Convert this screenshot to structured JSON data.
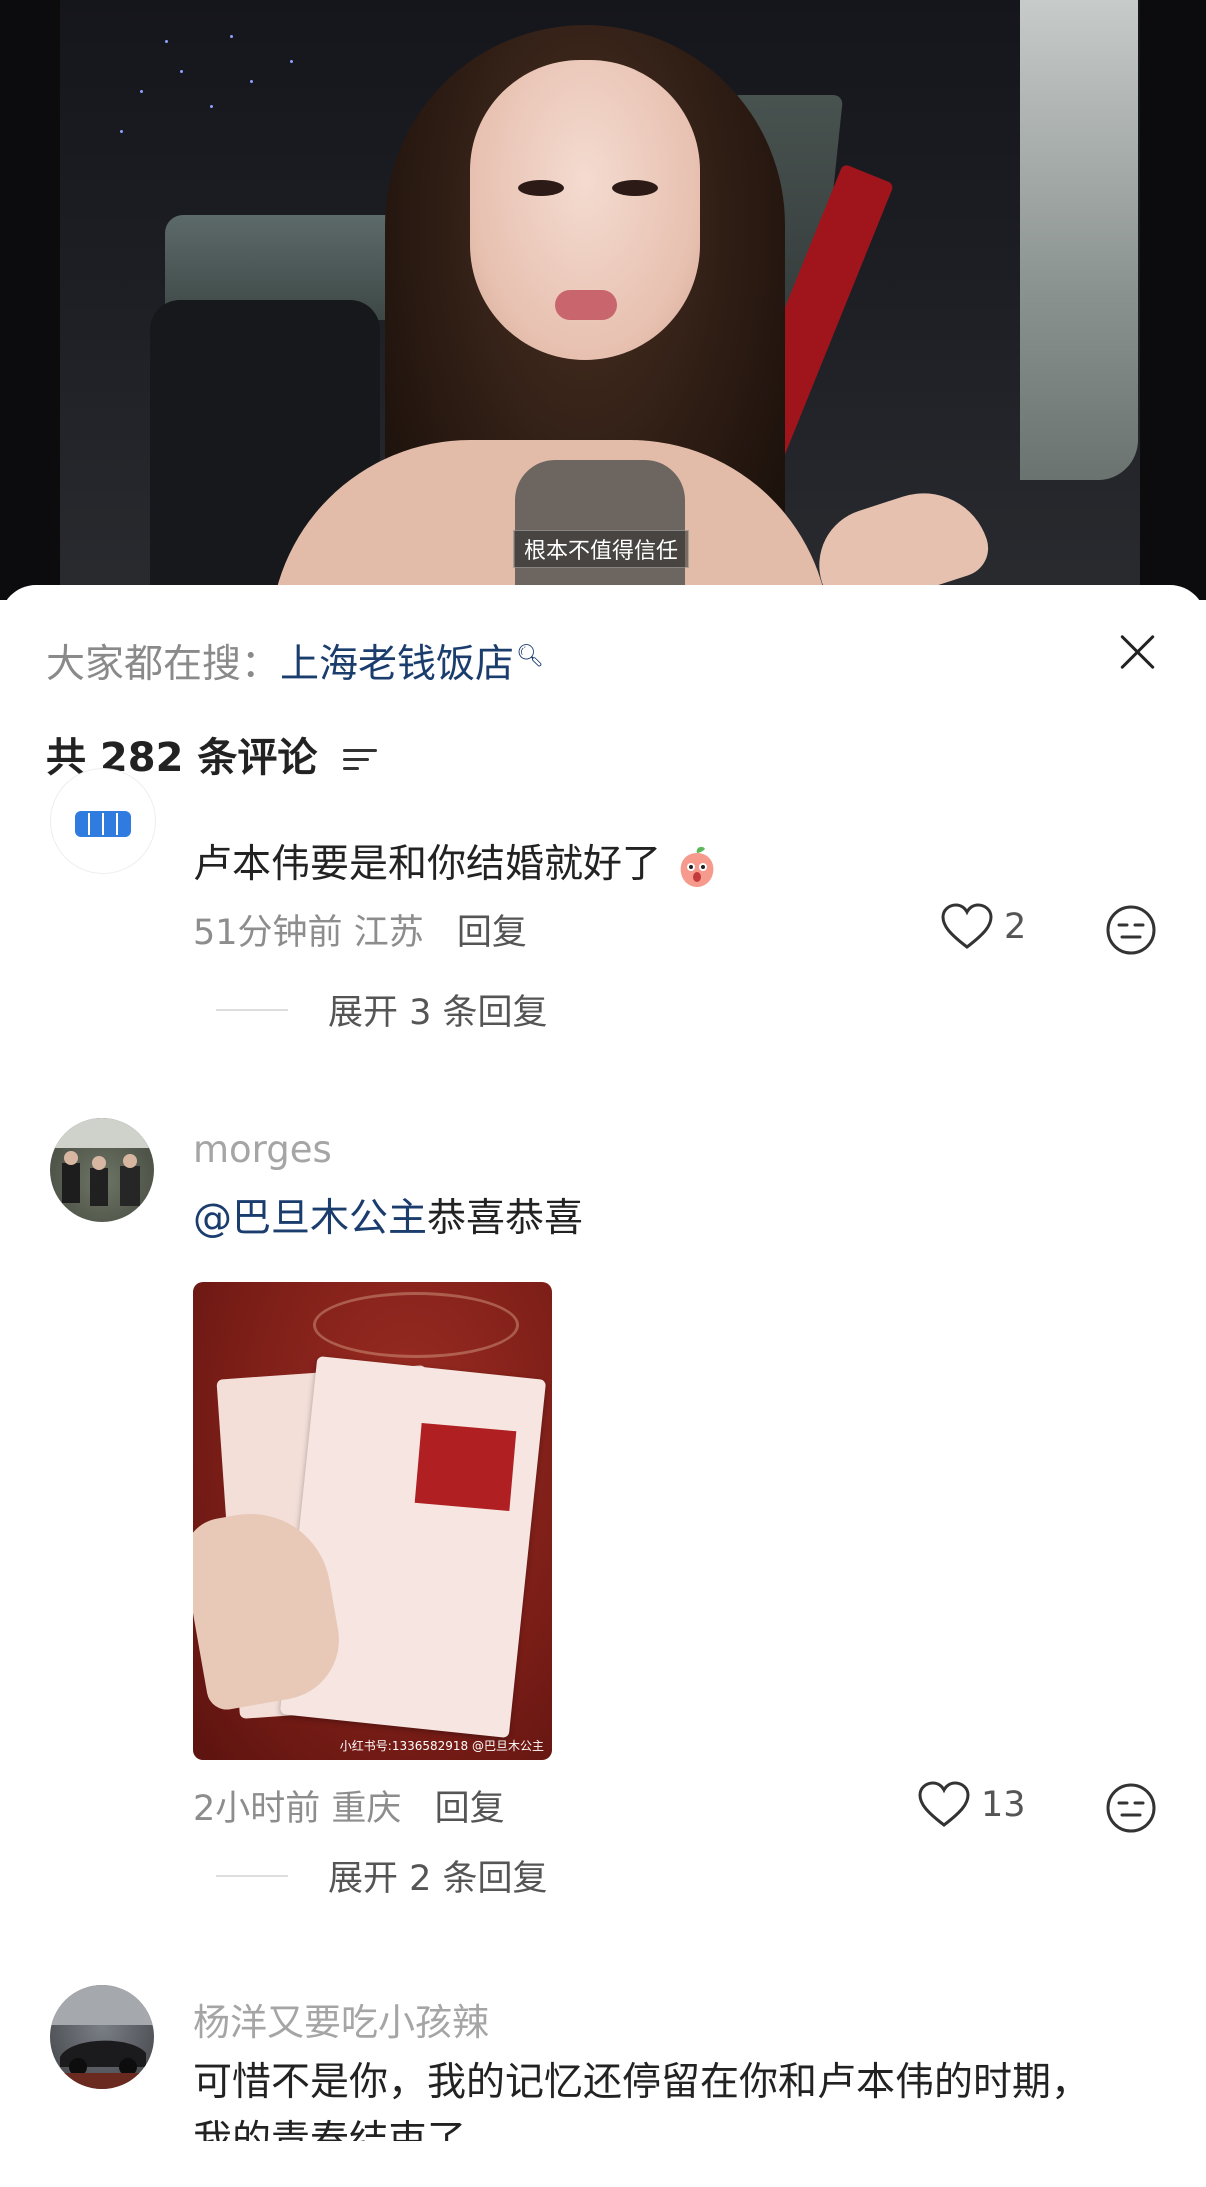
{
  "video": {
    "subtitle": "根本不值得信任"
  },
  "panel": {
    "search_prefix": "大家都在搜：",
    "search_term": "上海老钱饭店",
    "comment_count_label": "共 282 条评论"
  },
  "comments": [
    {
      "text": "卢本伟要是和你结婚就好了",
      "emoji": "peach-face-icon",
      "time": "51分钟前",
      "location": "江苏",
      "reply_label": "回复",
      "likes": "2",
      "expand_label": "展开 3 条回复"
    },
    {
      "username": "morges",
      "mention": "@巴旦木公主",
      "text": "恭喜恭喜",
      "image_watermark": "小红书号:1336582918 @巴旦木公主",
      "time": "2小时前",
      "location": "重庆",
      "reply_label": "回复",
      "likes": "13",
      "expand_label": "展开 2 条回复"
    },
    {
      "username": "杨洋又要吃小孩辣",
      "text_line1": "可惜不是你，我的记忆还停留在你和卢本伟的时期，",
      "text_line2": "我的青春结束了"
    }
  ]
}
